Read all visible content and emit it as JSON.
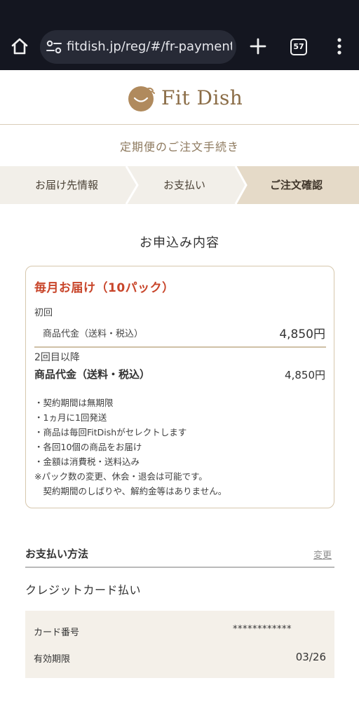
{
  "browser": {
    "url": "fitdish.jp/reg/#/fr-payment-",
    "tab_count": "57"
  },
  "header": {
    "brand": "Fit Dish",
    "subtitle": "定期便のご注文手続き"
  },
  "steps": [
    {
      "label": "お届け先情報"
    },
    {
      "label": "お支払い"
    },
    {
      "label": "ご注文確認"
    }
  ],
  "order": {
    "section_title": "お申込み内容",
    "plan_title": "毎月お届け（10パック）",
    "first": {
      "label": "初回",
      "row_label": "商品代金（送料・税込）",
      "price": "4,850円"
    },
    "second": {
      "label": "2回目以降",
      "row_label": "商品代金（送料・税込）",
      "price": "4,850円"
    },
    "notes": [
      "・契約期間は無期限",
      "・1ヵ月に1回発送",
      "・商品は毎回FitDishがセレクトします",
      "・各回10個の商品をお届け",
      "・金額は消費税・送料込み",
      "※パック数の変更、休会・退会は可能です。",
      "　契約期間のしばりや、解約金等はありません。"
    ]
  },
  "payment": {
    "heading": "お支払い方法",
    "change_label": "変更",
    "method": "クレジットカード払い",
    "card_number_label": "カード番号",
    "card_number_value": "************",
    "expiry_label": "有効期限",
    "expiry_value": "03/26"
  },
  "colors": {
    "accent": "#c8452a",
    "brand": "#8b6d47",
    "step_active": "#e5dac8",
    "step_inactive": "#f2efe9"
  }
}
